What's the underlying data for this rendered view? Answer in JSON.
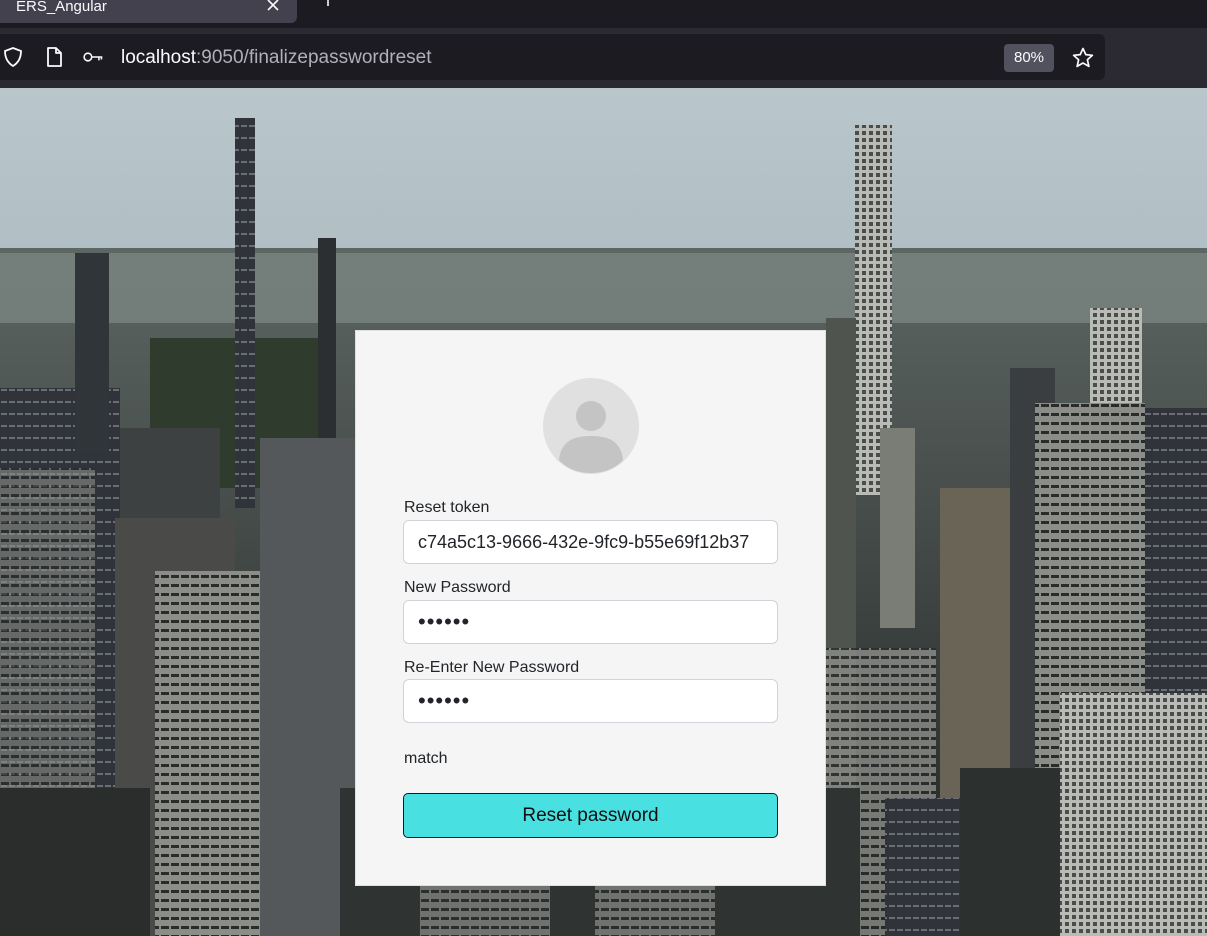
{
  "browser": {
    "tab_title": "ERS_Angular",
    "url_host": "localhost",
    "url_path": ":9050/finalizepasswordreset",
    "zoom": "80%",
    "icons": [
      "shield-icon",
      "page-icon",
      "key-icon",
      "bookmark-star-icon",
      "close-icon",
      "new-tab-icon"
    ]
  },
  "form": {
    "token_label": "Reset token",
    "token_value": "c74a5c13-9666-432e-9fc9-b55e69f12b37",
    "new_password_label": "New Password",
    "new_password_value": "••••••",
    "reenter_password_label": "Re-Enter New Password",
    "reenter_password_value": "••••••",
    "match_status": "match",
    "submit_label": "Reset password"
  },
  "colors": {
    "button": "#48e0e0",
    "card": "#f5f5f5",
    "chrome_dark": "#1c1b22",
    "chrome_mid": "#2b2a33"
  }
}
